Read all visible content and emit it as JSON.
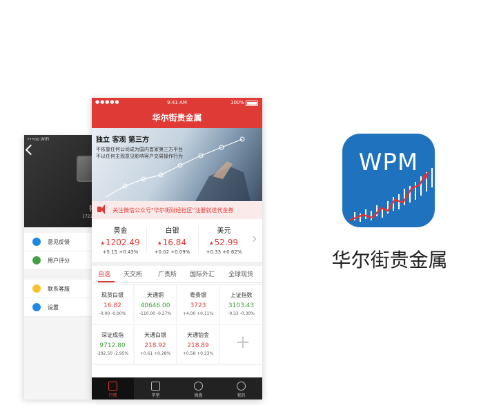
{
  "back_phone": {
    "status_text": "•••oo WiFi",
    "name_text": "张",
    "phone_text": "1722",
    "menu": [
      {
        "label": "意见反馈",
        "icon": "chat-icon",
        "color": "#1e88e5"
      },
      {
        "label": "用户评分",
        "icon": "rating-icon",
        "color": "#43a047"
      },
      {
        "label": "联系客服",
        "icon": "service-icon",
        "color": "#fbc02d"
      },
      {
        "label": "设置",
        "icon": "gear-icon",
        "color": "#1e88e5"
      }
    ]
  },
  "status_bar": {
    "signal": "●●●●● ",
    "time": "9:41 AM",
    "battery": "100%"
  },
  "nav_title": "华尔街贵金属",
  "banner": {
    "headline": "独立 客观 第三方",
    "line1": "不依靠任何公司成为国内首家第三方平台",
    "line2": "不以任何主观意见影响客户交易操作行为"
  },
  "notice": "关注微信公众号\"华尔街财经社区\"注册就送代金券",
  "quotes": [
    {
      "name": "黄金",
      "price": "1202.49",
      "change": "+5.15 +0.43%"
    },
    {
      "name": "白银",
      "price": "16.84",
      "change": "+0.02 +0.09%"
    },
    {
      "name": "美元",
      "price": "52.99",
      "change": "+0.33 +0.62%"
    }
  ],
  "tabs": [
    "自选",
    "天交所",
    "广贵所",
    "国际外汇",
    "全球现货"
  ],
  "grid": [
    {
      "name": "现货白银",
      "price": "16.82",
      "change": "-0.00 -0.00%",
      "dir": "up"
    },
    {
      "name": "天通铜",
      "price": "40646.00",
      "change": "-110.00 -0.27%",
      "dir": "down"
    },
    {
      "name": "粤贵银",
      "price": "3723",
      "change": "+4.00 +0.11%",
      "dir": "up"
    },
    {
      "name": "上证指数",
      "price": "3103.43",
      "change": "-9.33 -0.30%",
      "dir": "down"
    },
    {
      "name": "深证成指",
      "price": "9712.80",
      "change": "-292.50 -2.95%",
      "dir": "down"
    },
    {
      "name": "天通白银",
      "price": "218.92",
      "change": "+0.61 +0.28%",
      "dir": "up"
    },
    {
      "name": "天通铂金",
      "price": "218.89",
      "change": "+0.58 +0.23%",
      "dir": "up"
    }
  ],
  "tabbar": [
    {
      "label": "行情",
      "icon": "chart-icon",
      "active": true
    },
    {
      "label": "学堂",
      "icon": "book-icon",
      "active": false
    },
    {
      "label": "微盘",
      "icon": "exchange-icon",
      "active": false
    },
    {
      "label": "我的",
      "icon": "user-icon",
      "active": false
    }
  ],
  "app_icon_text": "WPM",
  "app_name": "华尔街贵金属",
  "colors": {
    "brand_red": "#e03a36",
    "icon_blue": "#1f72be",
    "up": "#e03a36",
    "down": "#3aa23a"
  }
}
